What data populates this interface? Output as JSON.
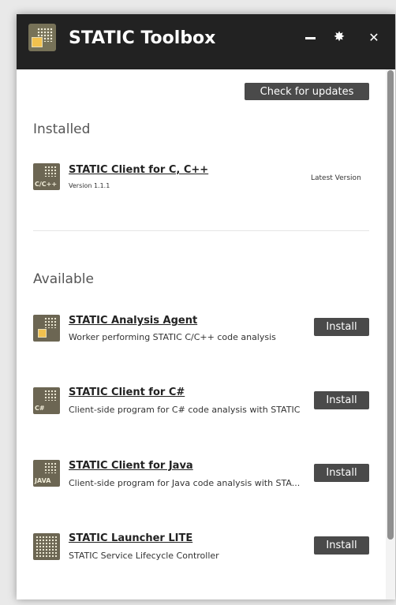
{
  "app": {
    "title": "STATIC Toolbox"
  },
  "toolbar": {
    "check_updates": "Check for updates"
  },
  "installed": {
    "title": "Installed",
    "items": [
      {
        "name": "STATIC Client for C, C++",
        "version": "Version 1.1.1",
        "status": "Latest Version",
        "badge": "C/C++"
      }
    ]
  },
  "available": {
    "title": "Available",
    "items": [
      {
        "name": "STATIC Analysis Agent",
        "description": "Worker performing STATIC C/C++ code analysis",
        "action": "Install"
      },
      {
        "name": "STATIC Client for C#",
        "description": "Client-side program for C# code analysis with STATIC",
        "action": "Install",
        "badge": "C#"
      },
      {
        "name": "STATIC Client for Java",
        "description": "Client-side program for Java code analysis with STA...",
        "action": "Install",
        "badge": "JAVA"
      },
      {
        "name": "STATIC Launcher LITE",
        "description": "STATIC Service Lifecycle Controller",
        "action": "Install"
      }
    ]
  },
  "icons": {
    "minimize": "minimize-icon",
    "settings": "gear-icon",
    "close": "close-icon"
  },
  "colors": {
    "titlebar": "#222222",
    "button": "#4a4a4a",
    "icon_bg": "#6c6653",
    "accent_yellow": "#f2c14e"
  }
}
